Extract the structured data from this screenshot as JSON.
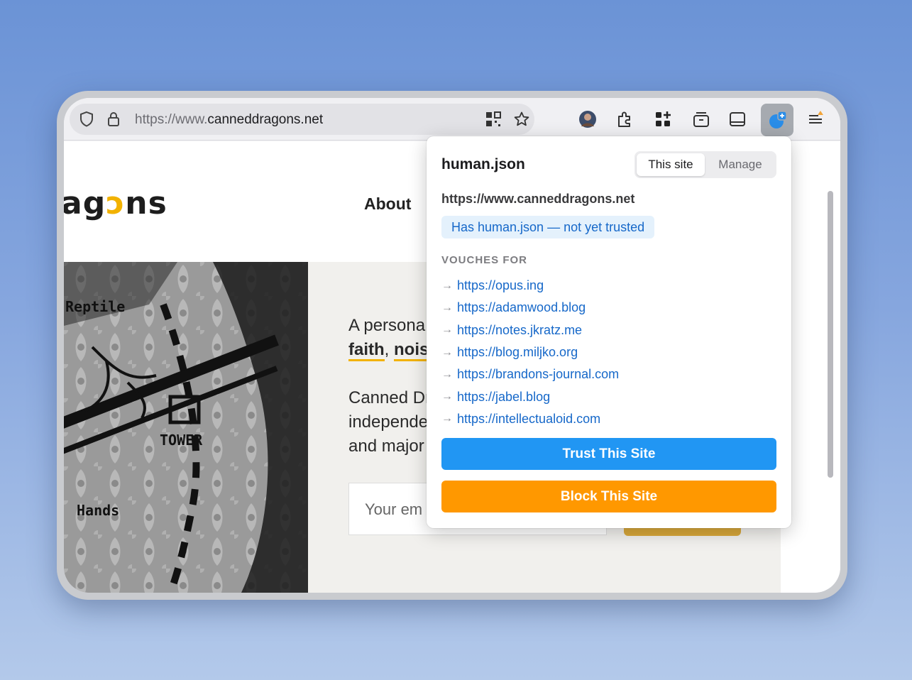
{
  "browser": {
    "url_prefix": "https://www.",
    "url_domain": "canneddragons.net"
  },
  "site": {
    "brand_visible": "agons",
    "nav_about": "About",
    "hero_line1": "A persona",
    "hero_faith": "faith",
    "hero_comma": ", ",
    "hero_noise": "nois",
    "hero_line3": "Canned Dr",
    "hero_line4": "independe",
    "hero_line5": "and major",
    "email_placeholder": "Your em"
  },
  "popup": {
    "title": "human.json",
    "tabs": [
      "This site",
      "Manage"
    ],
    "site_url": "https://www.canneddragons.net",
    "status": "Has human.json — not yet trusted",
    "vouches_heading": "VOUCHES FOR",
    "vouches": [
      "https://opus.ing",
      "https://adamwood.blog",
      "https://notes.jkratz.me",
      "https://blog.miljko.org",
      "https://brandons-journal.com",
      "https://jabel.blog",
      "https://intellectualoid.com"
    ],
    "trust_label": "Trust This Site",
    "block_label": "Block This Site"
  },
  "colors": {
    "trust": "#2196f3",
    "block": "#ff9800",
    "link": "#1668c9",
    "accent": "#f2b200"
  }
}
